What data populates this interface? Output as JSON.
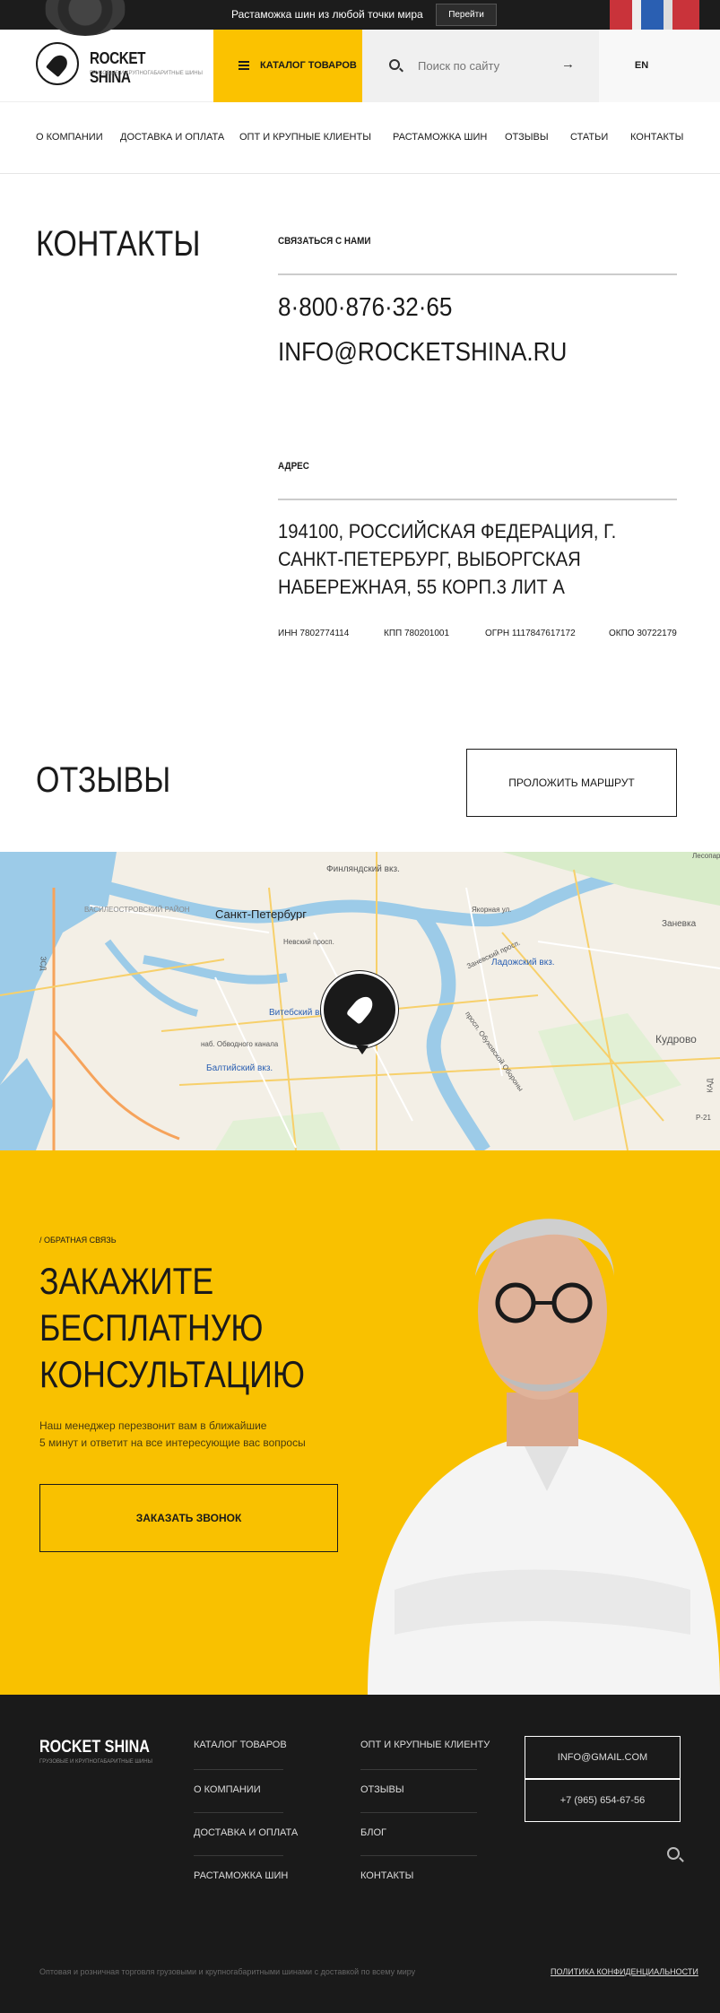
{
  "top_banner": {
    "text": "Растаможка шин из любой точки мира",
    "button_label": "Перейти"
  },
  "header": {
    "logo_name": "ROCKET SHINA",
    "logo_subtitle": "ГРУЗОВЫЕ И КРУПНОГАБАРИТНЫЕ ШИНЫ",
    "catalog_label": "КАТАЛОГ ТОВАРОВ",
    "search_placeholder": "Поиск по сайту",
    "lang": "EN"
  },
  "nav": [
    "О КОМПАНИИ",
    "ДОСТАВКА И ОПЛАТА",
    "ОПТ И КРУПНЫЕ КЛИЕНТЫ",
    "РАСТАМОЖКА ШИН",
    "ОТЗЫВЫ",
    "СТАТЬИ",
    "КОНТАКТЫ"
  ],
  "contacts": {
    "title": "КОНТАКТЫ",
    "contact_label": "СВЯЗАТЬСЯ С НАМИ",
    "phone": "8·800·876·32·65",
    "email": "INFO@ROCKETSHINA.RU",
    "address_label": "АДРЕС",
    "address": "194100, РОССИЙСКАЯ ФЕДЕРАЦИЯ, Г. САНКТ-ПЕТЕРБУРГ, ВЫБОРГСКАЯ НАБЕРЕЖНАЯ, 55 КОРП.3 ЛИТ А",
    "inn": "ИНН 7802774114",
    "kpp": "КПП 780201001",
    "ogrn": "ОГРН 1117847617172",
    "okpo": "ОКПО 30722179"
  },
  "reviews": {
    "title": "ОТЗЫВЫ",
    "route_button": "ПРОЛОЖИТЬ МАРШРУТ"
  },
  "map": {
    "labels": {
      "spb": "Санкт-Петербург",
      "vasil": "ВАСИЛЕОСТРОВСКИЙ РАЙОН",
      "finl": "Финляндский вкз.",
      "ladozh": "Ладожский вкз.",
      "vitebsk": "Витебский вкз.",
      "balt": "Балтийский вкз.",
      "kudrovo": "Кудрово",
      "zanevka": "Заневка",
      "nevsky": "Невский просп.",
      "yakor": "Якорная ул.",
      "zanevsky": "Заневский просп.",
      "obuh": "просп. Обуховской Обороны",
      "obvod": "наб. Обводного канала",
      "lesopark": "Лесопар",
      "p21": "Р-21",
      "kad": "КАД",
      "zsd": "ЗСД"
    }
  },
  "cta": {
    "kicker": "/ ОБРАТНАЯ СВЯЗЬ",
    "title": "ЗАКАЖИТЕ БЕСПЛАТНУЮ КОНСУЛЬТАЦИЮ",
    "desc_line1": "Наш менеджер перезвонит вам в ближайшие",
    "desc_line2": "5 минут и ответит на все интересующие вас вопросы",
    "button": "ЗАКАЗАТЬ ЗВОНОК"
  },
  "footer": {
    "logo_name": "ROCKET SHINA",
    "logo_subtitle": "ГРУЗОВЫЕ И КРУПНОГАБАРИТНЫЕ ШИНЫ",
    "col1": [
      "КАТАЛОГ ТОВАРОВ",
      "О КОМПАНИИ",
      "ДОСТАВКА И ОПЛАТА",
      "РАСТАМОЖКА ШИН"
    ],
    "col2": [
      "ОПТ И КРУПНЫЕ КЛИЕНТУ",
      "ОТЗЫВЫ",
      "БЛОГ",
      "КОНТАКТЫ"
    ],
    "email": "INFO@GMAIL.COM",
    "phone": "+7 (965) 654-67-56",
    "bottom_text": "Оптовая и розничная торговля грузовыми и крупногабаритными шинами с доставкой по всему миру",
    "policy": "ПОЛИТИКА КОНФИДЕНЦИАЛЬНОСТИ"
  },
  "colors": {
    "accent": "#fbc200",
    "dark": "#1a1a1a"
  }
}
